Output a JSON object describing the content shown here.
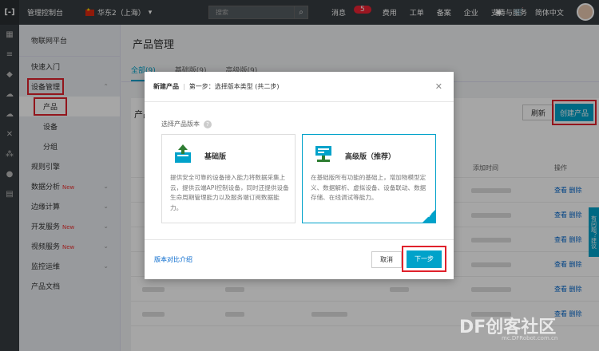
{
  "topbar": {
    "logo": "[-]",
    "console": "管理控制台",
    "region": "华东2（上海）",
    "search_placeholder": "搜索",
    "nav": [
      {
        "label": "消息",
        "badge": "5"
      },
      {
        "label": "费用"
      },
      {
        "label": "工单"
      },
      {
        "label": "备案"
      },
      {
        "label": "企业"
      },
      {
        "label": "支持与服务"
      }
    ],
    "lang": "简体中文"
  },
  "sidebar": {
    "header": "物联网平台",
    "items": [
      {
        "label": "快速入门"
      },
      {
        "label": "设备管理"
      },
      {
        "label": "产品"
      },
      {
        "label": "设备"
      },
      {
        "label": "分组"
      },
      {
        "label": "规则引擎"
      },
      {
        "label": "数据分析",
        "new": "New"
      },
      {
        "label": "边缘计算"
      },
      {
        "label": "开发服务",
        "new": "New"
      },
      {
        "label": "视频服务",
        "new": "New"
      },
      {
        "label": "监控运维"
      },
      {
        "label": "产品文档"
      }
    ]
  },
  "main": {
    "title": "产品管理",
    "tabs": [
      "全部(9)",
      "基础版(9)",
      "高级版(9)"
    ],
    "card_title": "产品",
    "refresh": "刷新",
    "create": "创建产品",
    "col_time": "添加时间",
    "col_op": "操作",
    "op_view": "查看",
    "op_delete": "删除",
    "helper": "有问题？建议"
  },
  "modal": {
    "title": "新建产品",
    "step": "第一步：选择版本类型 (共二步)",
    "label": "选择产品版本",
    "basic": {
      "title": "基础版",
      "desc": "提供安全可靠的设备接入能力将数据采集上云，提供云端API控制设备，同时还提供设备生命周期管理能力以及服务端订阅数据能力。"
    },
    "advanced": {
      "title": "高级版（推荐）",
      "desc": "在基础版所有功能的基础上，增加物模型定义、数据解析、虚拟设备、设备联动、数据存储、在线调试等能力。"
    },
    "compare": "版本对比介绍",
    "cancel": "取消",
    "next": "下一步"
  },
  "watermark": {
    "text": "DF创客社区",
    "sub": "mc.DFRobot.com.cn"
  },
  "colors": {
    "accent": "#00a2ca",
    "topbar": "#373d41",
    "highlight": "#e0212b"
  }
}
